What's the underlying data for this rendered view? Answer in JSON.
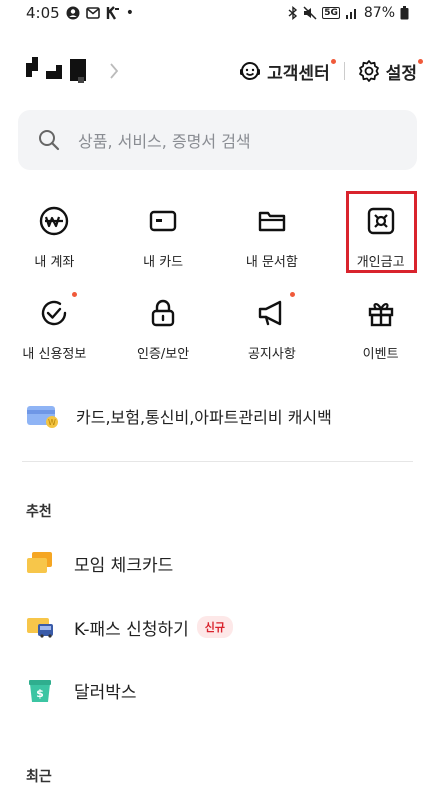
{
  "status_bar": {
    "time": "4:05",
    "battery": "87%",
    "signal_label": "5G"
  },
  "header": {
    "support_label": "고객센터",
    "settings_label": "설정"
  },
  "search": {
    "placeholder": "상품, 서비스, 증명서 검색"
  },
  "menu": [
    {
      "label": "내 계좌",
      "icon": "won-circle-icon"
    },
    {
      "label": "내 카드",
      "icon": "card-icon"
    },
    {
      "label": "내 문서함",
      "icon": "folder-icon"
    },
    {
      "label": "개인금고",
      "icon": "safe-icon"
    },
    {
      "label": "내 신용정보",
      "icon": "credit-check-icon"
    },
    {
      "label": "인증/보안",
      "icon": "lock-icon"
    },
    {
      "label": "공지사항",
      "icon": "megaphone-icon"
    },
    {
      "label": "이벤트",
      "icon": "gift-icon"
    }
  ],
  "promo": {
    "label": "카드,보험,통신비,아파트관리비 캐시백"
  },
  "recommended": {
    "title": "추천",
    "items": [
      {
        "label": "모임 체크카드",
        "icon": "card-stack-icon"
      },
      {
        "label": "K-패스 신청하기",
        "icon": "bus-card-icon",
        "badge": "신규"
      },
      {
        "label": "달러박스",
        "icon": "dollar-box-icon"
      }
    ]
  },
  "recent": {
    "title": "최근"
  },
  "colors": {
    "accent_dot": "#f05a3a",
    "highlight": "#d9232d",
    "search_bg": "#f3f4f6"
  }
}
